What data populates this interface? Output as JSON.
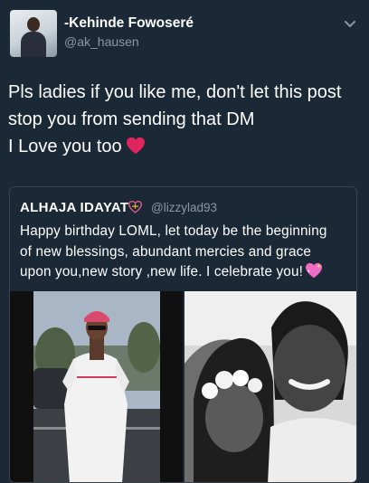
{
  "tweet": {
    "display_name": "-Kehinde Fowoseré",
    "handle": "@ak_hausen",
    "lines": [
      "Pls ladies if you like me, don't let this post",
      "stop you from sending that DM",
      "I Love you too"
    ],
    "emoji_icon": "red-heart-icon"
  },
  "quoted_tweet": {
    "display_name": "ALHAJA IDAYAT",
    "name_icon": "ribbon-heart-icon",
    "handle": "@lizzylad93",
    "lines": [
      "Happy birthday LOML, let today be the beginning",
      "of new blessings, abundant mercies and grace",
      "upon you,new story ,new life. I celebrate you!"
    ],
    "emoji_icon": "sparkling-heart-icon",
    "photos": [
      "photo-man-standing",
      "photo-couple-selfie"
    ]
  },
  "colors": {
    "background": "#1b2836",
    "secondary_text": "#8899a6",
    "border": "#38444d",
    "heart": "#e0245e"
  }
}
